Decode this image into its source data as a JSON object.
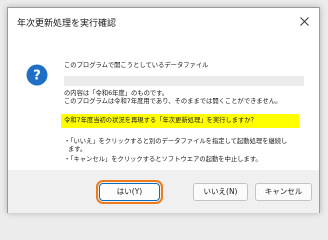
{
  "dialog": {
    "title": "年次更新処理を実行確認"
  },
  "message": {
    "line1": "このプログラムで開こうとしているデータファイル",
    "line2": "の内容は「令和6年度」のものです。",
    "line3": "このプログラムは令和7年度用であり、そのままでは開くことができません。",
    "highlight": "令和7年度当初の状況を再現する「年次更新処理」を実行しますか？",
    "bullet1": "・「いいえ」をクリックすると別のデータファイルを指定して起動処理を継続し",
    "bullet1_cont": "ます。",
    "bullet2": "・「キャンセル」をクリックするとソフトウエアの起動を中止します。"
  },
  "buttons": {
    "yes": "はい(Y)",
    "no": "いいえ(N)",
    "cancel": "キャンセル"
  },
  "icons": {
    "info": "info-icon",
    "close": "close-icon"
  },
  "colors": {
    "info_icon": "#1f6fc5",
    "highlight": "#ffff00",
    "focus_ring": "#f07b1a",
    "default_button_border": "#0f6cbd"
  }
}
